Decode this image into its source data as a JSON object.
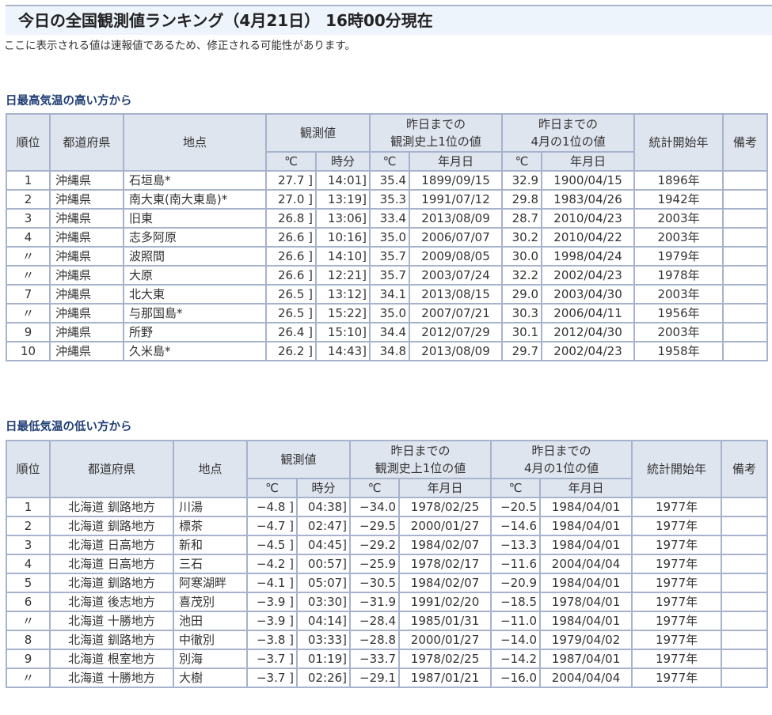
{
  "page_title": "今日の全国観測値ランキング（4月21日） 16時00分現在",
  "notice": "ここに表示される値は速報値であるため、修正される可能性があります。",
  "headers": {
    "rank": "順位",
    "pref": "都道府県",
    "station": "地点",
    "observed": "観測値",
    "record_all": "昨日までの\n観測史上1位の値",
    "record_all_l1": "昨日までの",
    "record_all_l2": "観測史上1位の値",
    "record_month_l1": "昨日までの",
    "record_month_l2": "4月の1位の値",
    "start_year": "統計開始年",
    "remarks": "備考",
    "deg": "℃",
    "time": "時分",
    "date": "年月日"
  },
  "tables": [
    {
      "heading": "日最高気温の高い方から",
      "rows": [
        [
          "1",
          "沖縄県",
          "石垣島*",
          "27.7 ]",
          "14:01]",
          "35.4",
          "1899/09/15",
          "32.9",
          "1900/04/15",
          "1896年",
          ""
        ],
        [
          "2",
          "沖縄県",
          "南大東(南大東島)*",
          "27.0 ]",
          "13:19]",
          "35.3",
          "1991/07/12",
          "29.8",
          "1983/04/26",
          "1942年",
          ""
        ],
        [
          "3",
          "沖縄県",
          "旧東",
          "26.8 ]",
          "13:06]",
          "33.4",
          "2013/08/09",
          "28.7",
          "2010/04/23",
          "2003年",
          ""
        ],
        [
          "4",
          "沖縄県",
          "志多阿原",
          "26.6 ]",
          "10:16]",
          "35.0",
          "2006/07/07",
          "30.2",
          "2010/04/22",
          "2003年",
          ""
        ],
        [
          "〃",
          "沖縄県",
          "波照間",
          "26.6 ]",
          "14:10]",
          "35.7",
          "2009/08/05",
          "30.0",
          "1998/04/24",
          "1979年",
          ""
        ],
        [
          "〃",
          "沖縄県",
          "大原",
          "26.6 ]",
          "12:21]",
          "35.7",
          "2003/07/24",
          "32.2",
          "2002/04/23",
          "1978年",
          ""
        ],
        [
          "7",
          "沖縄県",
          "北大東",
          "26.5 ]",
          "13:12]",
          "34.1",
          "2013/08/15",
          "29.0",
          "2003/04/30",
          "2003年",
          ""
        ],
        [
          "〃",
          "沖縄県",
          "与那国島*",
          "26.5 ]",
          "15:22]",
          "35.0",
          "2007/07/21",
          "30.3",
          "2006/04/11",
          "1956年",
          ""
        ],
        [
          "9",
          "沖縄県",
          "所野",
          "26.4 ]",
          "15:10]",
          "34.4",
          "2012/07/29",
          "30.1",
          "2012/04/30",
          "2003年",
          ""
        ],
        [
          "10",
          "沖縄県",
          "久米島*",
          "26.2 ]",
          "14:43]",
          "34.8",
          "2013/08/09",
          "29.7",
          "2002/04/23",
          "1958年",
          ""
        ]
      ]
    },
    {
      "heading": "日最低気温の低い方から",
      "rows": [
        [
          "1",
          "北海道 釧路地方",
          "川湯",
          "−4.8 ]",
          "04:38]",
          "−34.0",
          "1978/02/25",
          "−20.5",
          "1984/04/01",
          "1977年",
          ""
        ],
        [
          "2",
          "北海道 釧路地方",
          "標茶",
          "−4.7 ]",
          "02:47]",
          "−29.5",
          "2000/01/27",
          "−14.6",
          "1984/04/01",
          "1977年",
          ""
        ],
        [
          "3",
          "北海道 日高地方",
          "新和",
          "−4.5 ]",
          "04:45]",
          "−29.2",
          "1984/02/07",
          "−13.3",
          "1984/04/01",
          "1977年",
          ""
        ],
        [
          "4",
          "北海道 日高地方",
          "三石",
          "−4.2 ]",
          "00:57]",
          "−25.9",
          "1978/02/17",
          "−11.6",
          "2004/04/04",
          "1977年",
          ""
        ],
        [
          "5",
          "北海道 釧路地方",
          "阿寒湖畔",
          "−4.1 ]",
          "05:07]",
          "−30.5",
          "1984/02/07",
          "−20.9",
          "1984/04/01",
          "1977年",
          ""
        ],
        [
          "6",
          "北海道 後志地方",
          "喜茂別",
          "−3.9 ]",
          "03:30]",
          "−31.9",
          "1991/02/20",
          "−18.5",
          "1978/04/01",
          "1977年",
          ""
        ],
        [
          "〃",
          "北海道 十勝地方",
          "池田",
          "−3.9 ]",
          "04:14]",
          "−28.4",
          "1985/01/31",
          "−11.0",
          "1984/04/01",
          "1977年",
          ""
        ],
        [
          "8",
          "北海道 釧路地方",
          "中徹別",
          "−3.8 ]",
          "03:33]",
          "−28.8",
          "2000/01/27",
          "−14.0",
          "1979/04/02",
          "1977年",
          ""
        ],
        [
          "9",
          "北海道 根室地方",
          "別海",
          "−3.7 ]",
          "01:19]",
          "−33.7",
          "1978/02/25",
          "−14.2",
          "1987/04/01",
          "1977年",
          ""
        ],
        [
          "〃",
          "北海道 十勝地方",
          "大樹",
          "−3.7 ]",
          "02:26]",
          "−29.1",
          "1987/01/21",
          "−16.0",
          "2004/04/04",
          "1977年",
          ""
        ]
      ]
    }
  ]
}
